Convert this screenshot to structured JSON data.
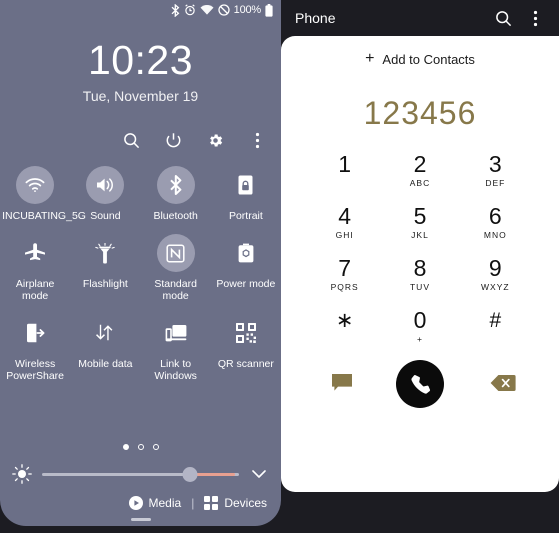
{
  "statusbar": {
    "icons": [
      "bluetooth-icon",
      "alarm-icon",
      "wifi-icon",
      "do-not-disturb-icon"
    ],
    "battery_text": "100%",
    "battery_icon": "battery-full-icon"
  },
  "lockscreen": {
    "time": "10:23",
    "date": "Tue, November 19"
  },
  "quick_settings": {
    "toolbar": [
      {
        "name": "search-icon",
        "label": "Search"
      },
      {
        "name": "power-icon",
        "label": "Power"
      },
      {
        "name": "gear-icon",
        "label": "Settings"
      },
      {
        "name": "overflow-menu-icon",
        "label": "More options"
      }
    ],
    "tiles": [
      {
        "label": "INCUBATING_5G",
        "icon": "wifi-icon",
        "state": "on"
      },
      {
        "label": "Sound",
        "icon": "speaker-icon",
        "state": "on"
      },
      {
        "label": "Bluetooth",
        "icon": "bluetooth-icon",
        "state": "on"
      },
      {
        "label": "Portrait",
        "icon": "rotation-lock-icon",
        "state": "off"
      },
      {
        "label": "Airplane mode",
        "icon": "airplane-icon",
        "state": "off"
      },
      {
        "label": "Flashlight",
        "icon": "flashlight-icon",
        "state": "off"
      },
      {
        "label": "Standard mode",
        "icon": "nfc-icon",
        "state": "on"
      },
      {
        "label": "Power mode",
        "icon": "power-mode-icon",
        "state": "off"
      },
      {
        "label": "Wireless PowerShare",
        "icon": "wireless-powershare-icon",
        "state": "off"
      },
      {
        "label": "Mobile data",
        "icon": "mobile-data-icon",
        "state": "off"
      },
      {
        "label": "Link to Windows",
        "icon": "link-to-windows-icon",
        "state": "off"
      },
      {
        "label": "QR scanner",
        "icon": "qr-scanner-icon",
        "state": "off"
      }
    ],
    "pages": {
      "count": 3,
      "active": 1
    },
    "brightness": {
      "icon": "brightness-icon",
      "value": 75,
      "expand_icon": "chevron-down-icon"
    },
    "footer": {
      "media_label": "Media",
      "media_icon": "play-circle-icon",
      "separator": "|",
      "devices_label": "Devices",
      "devices_icon": "devices-grid-icon"
    }
  },
  "phone_app": {
    "title": "Phone",
    "header_actions": [
      {
        "name": "search-icon",
        "label": "Search"
      },
      {
        "name": "overflow-menu-icon",
        "label": "More options"
      }
    ],
    "add_to_contacts": {
      "plus": "+",
      "label": "Add to Contacts"
    },
    "dialed_number": "123456",
    "keypad": [
      [
        {
          "digit": "1",
          "sub": ""
        },
        {
          "digit": "2",
          "sub": "ABC"
        },
        {
          "digit": "3",
          "sub": "DEF"
        }
      ],
      [
        {
          "digit": "4",
          "sub": "GHI"
        },
        {
          "digit": "5",
          "sub": "JKL"
        },
        {
          "digit": "6",
          "sub": "MNO"
        }
      ],
      [
        {
          "digit": "7",
          "sub": "PQRS"
        },
        {
          "digit": "8",
          "sub": "TUV"
        },
        {
          "digit": "9",
          "sub": "WXYZ"
        }
      ],
      [
        {
          "digit": "∗",
          "sub": ""
        },
        {
          "digit": "0",
          "sub": "+"
        },
        {
          "digit": "#",
          "sub": ""
        }
      ]
    ],
    "actions": {
      "message_icon": "message-icon",
      "call_icon": "call-icon",
      "backspace_icon": "backspace-icon"
    }
  },
  "colors": {
    "panel_bg": "#6b6f87",
    "accent_olive": "#87784a",
    "tile_on": "#9a9cb0",
    "call_button": "#0b0b0b",
    "slider_hot": "#e8a090",
    "app_bg": "#ffffff"
  }
}
